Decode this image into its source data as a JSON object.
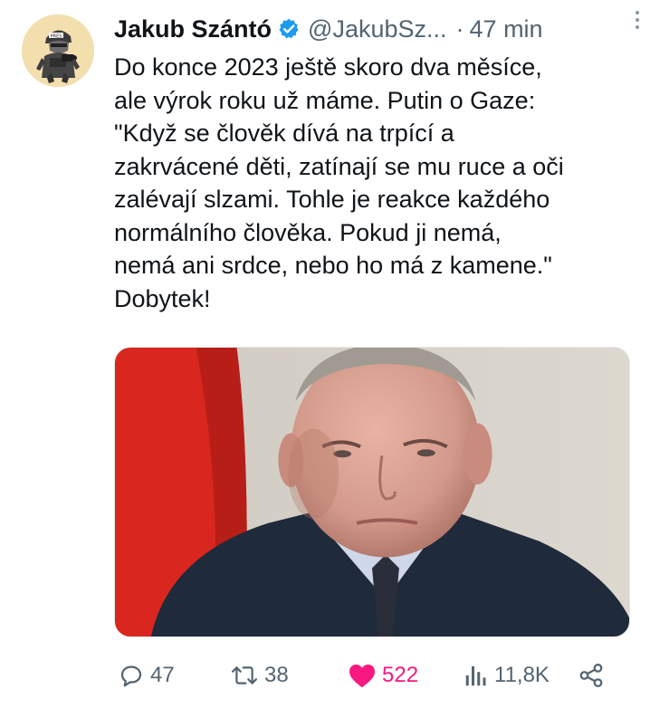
{
  "author": {
    "name": "Jakub Szántó",
    "handle": "@JakubSz...",
    "verified": true,
    "avatar_icon": "avatar-soldier-illustration"
  },
  "meta": {
    "separator": "·",
    "time": "47 min"
  },
  "tweet": {
    "lines": [
      "Do konce 2023 ještě skoro dva měsíce,",
      "ale výrok roku už máme. Putin o Gaze:",
      "\"Když se člověk dívá na trpící a",
      "zakrvácené děti, zatínají se mu ruce a oči",
      "zalévají slzami. Tohle je reakce každého",
      "normálního člověka. Pokud ji nemá,",
      "nemá ani srdce, nebo ho má z kamene.\"",
      "Dobytek!"
    ]
  },
  "media": {
    "type": "photo"
  },
  "actions": {
    "replies": "47",
    "retweets": "38",
    "likes": "522",
    "views": "11,8K",
    "liked": true
  },
  "colors": {
    "text": "#0f1419",
    "secondary": "#536471",
    "verified": "#1d9bf0",
    "like": "#f91880"
  },
  "icons": {
    "more": "more-dots-icon",
    "reply": "reply-icon",
    "retweet": "retweet-icon",
    "like": "heart-icon",
    "views": "views-icon",
    "share": "share-icon"
  }
}
